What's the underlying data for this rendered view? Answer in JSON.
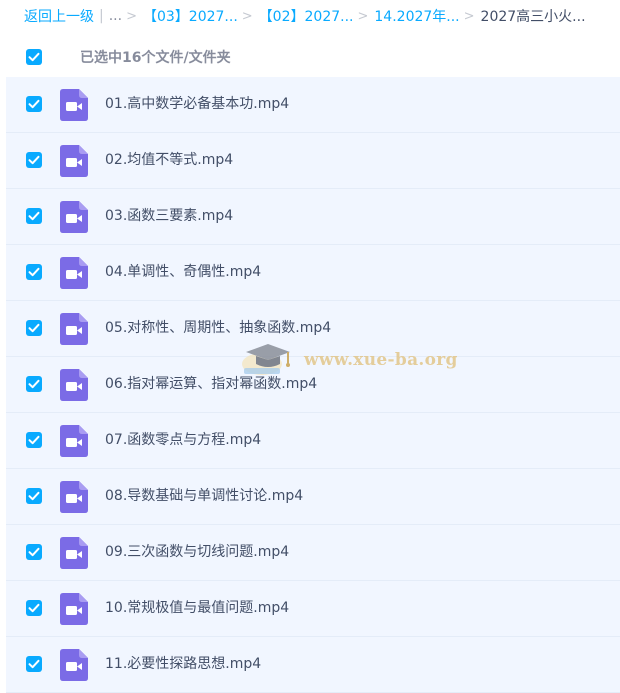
{
  "breadcrumb": {
    "back_label": "返回上一级",
    "ellipsis": "...",
    "items": [
      {
        "label": "【03】2027..."
      },
      {
        "label": "【02】2027..."
      },
      {
        "label": "14.2027年..."
      }
    ],
    "current": "2027高三小火..."
  },
  "selection": {
    "text": "已选中16个文件/文件夹",
    "all_checked": true
  },
  "colors": {
    "accent": "#09aaff",
    "video_icon": "#7b6be6",
    "row_selected_bg": "#f1f6ff",
    "watermark": "#e2c68a"
  },
  "file_icon": "video-file-icon",
  "files": [
    {
      "name": "01.高中数学必备基本功.mp4",
      "checked": true
    },
    {
      "name": "02.均值不等式.mp4",
      "checked": true
    },
    {
      "name": "03.函数三要素.mp4",
      "checked": true
    },
    {
      "name": "04.单调性、奇偶性.mp4",
      "checked": true
    },
    {
      "name": "05.对称性、周期性、抽象函数.mp4",
      "checked": true
    },
    {
      "name": "06.指对幂运算、指对幂函数.mp4",
      "checked": true
    },
    {
      "name": "07.函数零点与方程.mp4",
      "checked": true
    },
    {
      "name": "08.导数基础与单调性讨论.mp4",
      "checked": true
    },
    {
      "name": "09.三次函数与切线问题.mp4",
      "checked": true
    },
    {
      "name": "10.常规极值与最值问题.mp4",
      "checked": true
    },
    {
      "name": "11.必要性探路思想.mp4",
      "checked": true
    }
  ],
  "watermark": {
    "text": "www.xue-ba.org"
  }
}
